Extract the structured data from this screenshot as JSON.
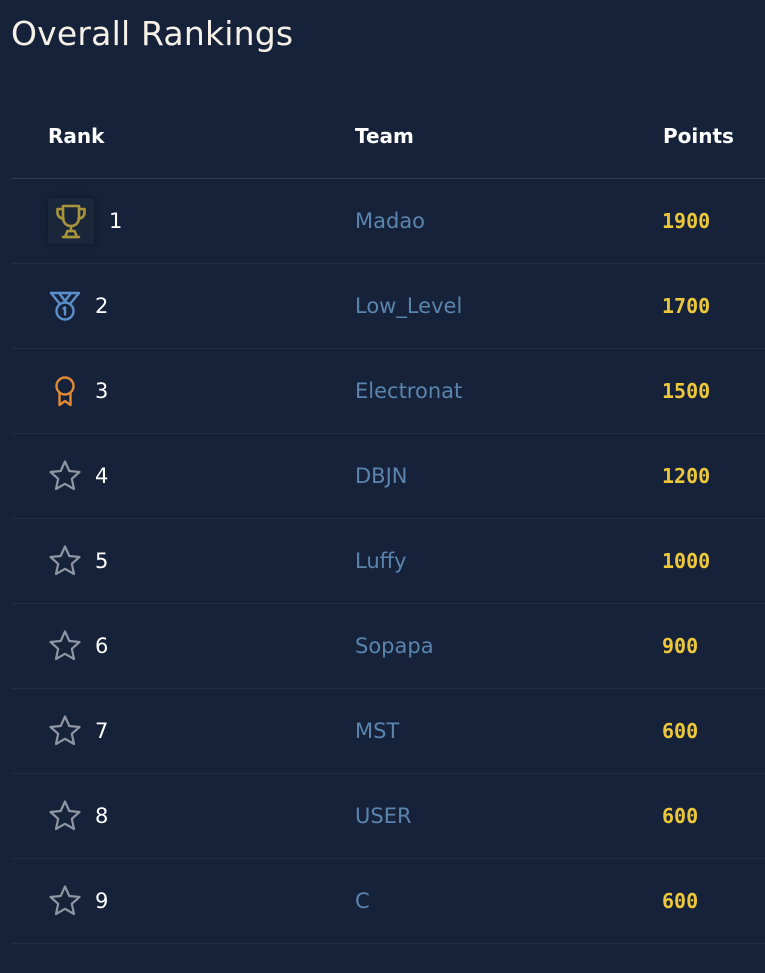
{
  "page": {
    "title": "Overall Rankings"
  },
  "table": {
    "columns": {
      "rank": "Rank",
      "team": "Team",
      "points": "Points"
    },
    "rows": [
      {
        "rank": "1",
        "team": "Madao",
        "points": "1900",
        "icon": "trophy-icon"
      },
      {
        "rank": "2",
        "team": "Low_Level",
        "points": "1700",
        "icon": "medal-icon"
      },
      {
        "rank": "3",
        "team": "Electronat",
        "points": "1500",
        "icon": "award-ribbon-icon"
      },
      {
        "rank": "4",
        "team": "DBJN",
        "points": "1200",
        "icon": "star-icon"
      },
      {
        "rank": "5",
        "team": "Luffy",
        "points": "1000",
        "icon": "star-icon"
      },
      {
        "rank": "6",
        "team": "Sopapa",
        "points": "900",
        "icon": "star-icon"
      },
      {
        "rank": "7",
        "team": "MST",
        "points": "600",
        "icon": "star-icon"
      },
      {
        "rank": "8",
        "team": "USER",
        "points": "600",
        "icon": "star-icon"
      },
      {
        "rank": "9",
        "team": "C",
        "points": "600",
        "icon": "star-icon"
      }
    ]
  },
  "colors": {
    "background": "#16223a",
    "team_link": "#5b84ad",
    "points": "#ecc73a",
    "trophy": "#a8943a",
    "medal": "#5b8fc9",
    "ribbon": "#e08a35",
    "star": "#8e96a3"
  }
}
